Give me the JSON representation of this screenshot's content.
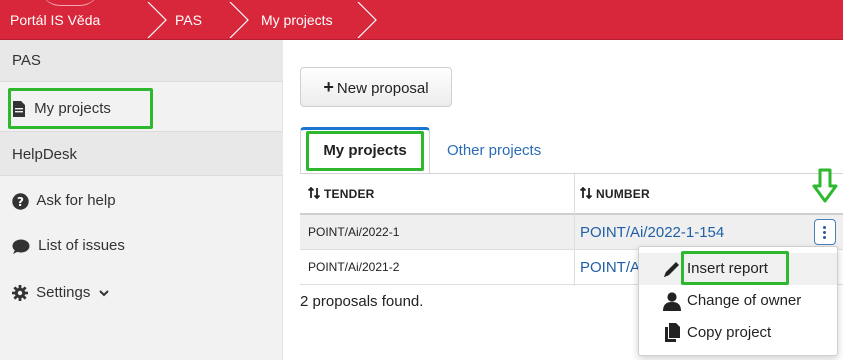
{
  "breadcrumb": {
    "items": [
      "Portál IS Věda",
      "PAS",
      "My projects"
    ]
  },
  "sidebar": {
    "items": [
      {
        "label": "PAS",
        "type": "header"
      },
      {
        "label": "My projects",
        "icon": "file-icon"
      },
      {
        "label": "HelpDesk",
        "type": "header"
      },
      {
        "label": "Ask for help",
        "icon": "question-circle-icon"
      },
      {
        "label": "List of issues",
        "icon": "comment-icon"
      },
      {
        "label": "Settings",
        "icon": "gear-icon"
      }
    ]
  },
  "main": {
    "new_proposal_label": "New proposal",
    "tabs": [
      {
        "label": "My projects",
        "active": true
      },
      {
        "label": "Other projects",
        "active": false
      }
    ],
    "table": {
      "columns": [
        "TENDER",
        "NUMBER"
      ],
      "rows": [
        {
          "tender": "POINT/Ai/2022-1",
          "number": "POINT/Ai/2022-1-154"
        },
        {
          "tender": "POINT/Ai/2021-2",
          "number": "POINT/A"
        }
      ]
    },
    "found_text": "2 proposals found."
  },
  "menu": {
    "items": [
      {
        "label": "Insert report",
        "icon": "pencil-icon"
      },
      {
        "label": "Change of owner",
        "icon": "user-icon"
      },
      {
        "label": "Copy project",
        "icon": "copy-icon"
      }
    ]
  },
  "colors": {
    "brand_red": "#d8263a",
    "highlight_green": "#2eb82e",
    "link_blue": "#1f5fa8"
  }
}
